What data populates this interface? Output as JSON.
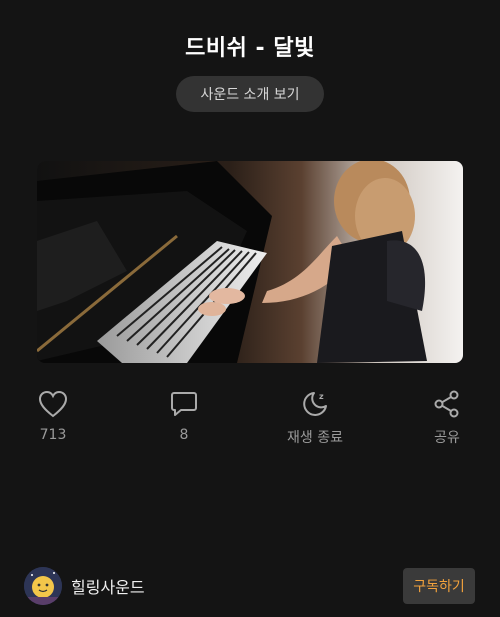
{
  "header": {
    "title": "드비쉬 - 달빛",
    "intro_button": "사운드 소개 보기"
  },
  "actions": [
    {
      "icon": "heart-icon",
      "label": "713"
    },
    {
      "icon": "comment-icon",
      "label": "8"
    },
    {
      "icon": "sleep-moon-icon",
      "label": "재생 종료"
    },
    {
      "icon": "share-icon",
      "label": "공유"
    }
  ],
  "channel": {
    "name": "힐링사운드",
    "subscribe_label": "구독하기"
  },
  "colors": {
    "background": "#141414",
    "accent": "#f2a23c",
    "button_bg": "#333333"
  }
}
